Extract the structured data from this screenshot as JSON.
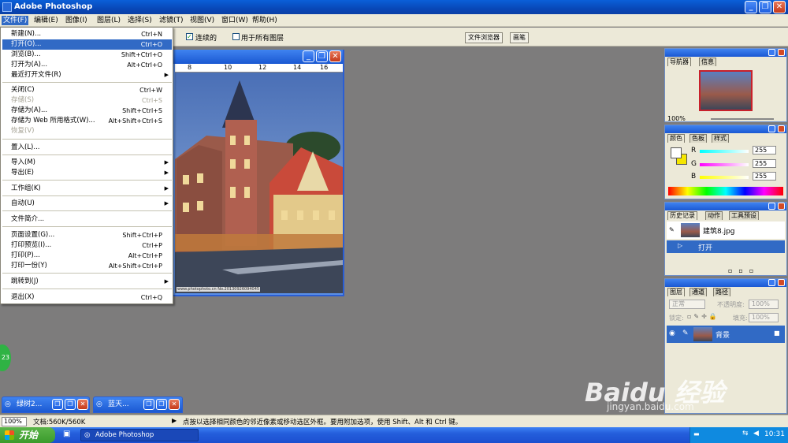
{
  "titlebar": {
    "title": "Adobe Photoshop"
  },
  "window_controls": {
    "minimize": "_",
    "restore": "❐",
    "close": "✕"
  },
  "menubar": [
    {
      "label": "文件(F)"
    },
    {
      "label": "编辑(E)"
    },
    {
      "label": "图像(I)"
    },
    {
      "label": "图层(L)"
    },
    {
      "label": "选择(S)"
    },
    {
      "label": "滤镜(T)"
    },
    {
      "label": "视图(V)"
    },
    {
      "label": "窗口(W)"
    },
    {
      "label": "帮助(H)"
    }
  ],
  "options": {
    "contiguous_label": "连续的",
    "all_layers_label": "用于所有图层",
    "file_browser": "文件浏览器",
    "brushes": "画笔"
  },
  "file_menu": [
    {
      "label": "新建(N)...",
      "shortcut": "Ctrl+N"
    },
    {
      "label": "打开(O)...",
      "shortcut": "Ctrl+O",
      "selected": true
    },
    {
      "label": "浏览(B)...",
      "shortcut": "Shift+Ctrl+O"
    },
    {
      "label": "打开为(A)...",
      "shortcut": "Alt+Ctrl+O"
    },
    {
      "label": "最近打开文件(R)",
      "shortcut": "",
      "submenu": true
    },
    {
      "label": "关闭(C)",
      "shortcut": "Ctrl+W"
    },
    {
      "label": "存储(S)",
      "shortcut": "Ctrl+S",
      "disabled": true
    },
    {
      "label": "存储为(A)...",
      "shortcut": "Shift+Ctrl+S"
    },
    {
      "label": "存储为 Web 所用格式(W)...",
      "shortcut": "Alt+Shift+Ctrl+S"
    },
    {
      "label": "恢复(V)",
      "shortcut": "",
      "disabled": true
    },
    {
      "label": "置入(L)...",
      "shortcut": ""
    },
    {
      "label": "导入(M)",
      "shortcut": "",
      "submenu": true
    },
    {
      "label": "导出(E)",
      "shortcut": "",
      "submenu": true
    },
    {
      "label": "工作组(K)",
      "shortcut": "",
      "submenu": true
    },
    {
      "label": "自动(U)",
      "shortcut": "",
      "submenu": true
    },
    {
      "label": "文件简介...",
      "shortcut": ""
    },
    {
      "label": "页面设置(G)...",
      "shortcut": "Shift+Ctrl+P"
    },
    {
      "label": "打印预览(I)...",
      "shortcut": "Ctrl+P"
    },
    {
      "label": "打印(P)...",
      "shortcut": "Alt+Ctrl+P"
    },
    {
      "label": "打印一份(Y)",
      "shortcut": "Alt+Shift+Ctrl+P"
    },
    {
      "label": "跳转到(J)",
      "shortcut": "",
      "submenu": true
    },
    {
      "label": "退出(X)",
      "shortcut": "Ctrl+Q"
    }
  ],
  "document": {
    "ruler_ticks": [
      "8",
      "10",
      "12",
      "14",
      "16"
    ],
    "credit": "www.photophoto.cn  No.20130926094045"
  },
  "navigator": {
    "tabs": [
      "导航器",
      "信息"
    ],
    "zoom": "100%"
  },
  "color_palette": {
    "tabs": [
      "颜色",
      "色板",
      "样式"
    ],
    "r": "255",
    "g": "255",
    "b": "255",
    "r_label": "R",
    "g_label": "G",
    "b_label": "B"
  },
  "history": {
    "tabs": [
      "历史记录",
      "动作",
      "工具预设"
    ],
    "snapshot": "建筑8.jpg",
    "state": "打开"
  },
  "layers": {
    "tabs": [
      "图层",
      "通道",
      "路径"
    ],
    "blend_mode": "正常",
    "opacity_label": "不透明度:",
    "opacity": "100%",
    "lock_label": "锁定:",
    "fill_label": "填充:",
    "fill": "100%",
    "layer_name": "背景"
  },
  "minimized": [
    {
      "title": "绿树2..."
    },
    {
      "title": "蓝天..."
    }
  ],
  "statusbar": {
    "zoom": "100%",
    "doc": "文档:560K/560K",
    "hint": "点按以选择相同颜色的邻近像素或移动选区外框。要用附加选项，使用 Shift、Alt 和 Ctrl 键。"
  },
  "taskbar": {
    "start": "开始",
    "task": "Adobe Photoshop",
    "clock": "10:31"
  },
  "watermark": {
    "brand": "Baidu 经验",
    "url": "jingyan.baidu.com"
  },
  "badge": "23"
}
